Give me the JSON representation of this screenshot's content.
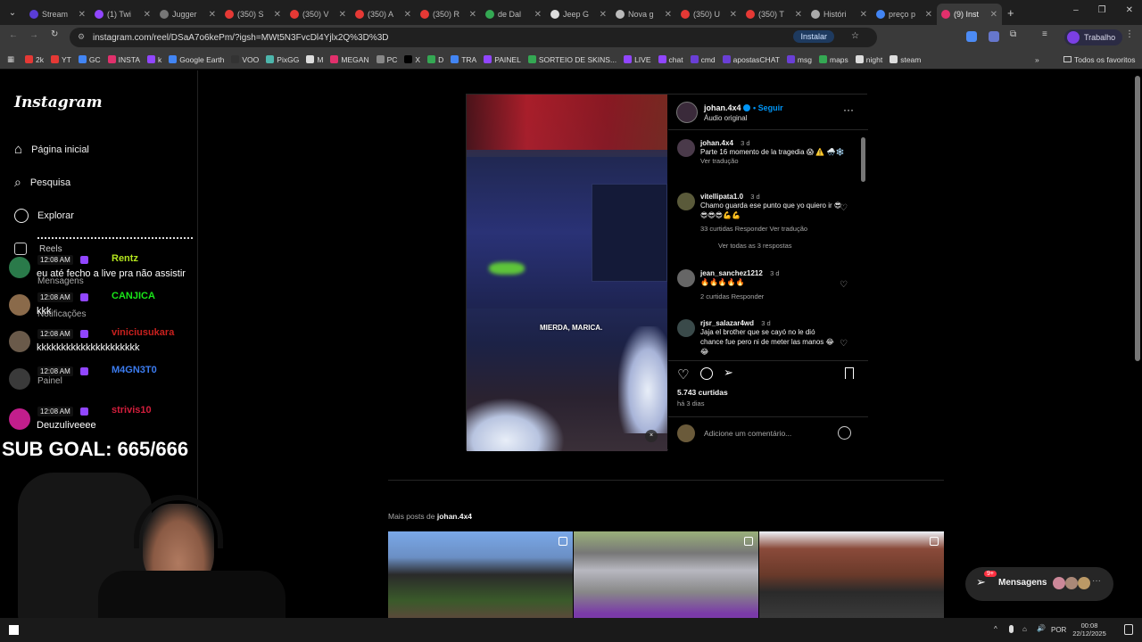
{
  "browser": {
    "tabs": [
      {
        "label": "Stream",
        "color": "#5a3dd6"
      },
      {
        "label": "(1) Twi",
        "color": "#9146ff"
      },
      {
        "label": "Jugger",
        "color": "#777777"
      },
      {
        "label": "(350) S",
        "color": "#e53935"
      },
      {
        "label": "(350) V",
        "color": "#e53935"
      },
      {
        "label": "(350) A",
        "color": "#e53935"
      },
      {
        "label": "(350) R",
        "color": "#e53935"
      },
      {
        "label": "de Dal",
        "color": "#34a853"
      },
      {
        "label": "Jeep G",
        "color": "#dddddd"
      },
      {
        "label": "Nova g",
        "color": "#bbbbbb"
      },
      {
        "label": "(350) U",
        "color": "#e53935"
      },
      {
        "label": "(350) T",
        "color": "#e53935"
      },
      {
        "label": "Históri",
        "color": "#aaaaaa"
      },
      {
        "label": "preço p",
        "color": "#4285f4"
      },
      {
        "label": "(9) Inst",
        "color": "#e1306c"
      }
    ],
    "url": "instagram.com/reel/DSaA7o6kePm/?igsh=MWt5N3FvcDl4Yjlx2Q%3D%3D",
    "install_label": "Instalar",
    "profile_label": "Trabalho",
    "bookmarks": [
      "2k",
      "YT",
      "GC",
      "INSTA",
      "k",
      "Google Earth",
      "VOO",
      "PixGG",
      "M",
      "MEGAN",
      "PC",
      "X",
      "D",
      "TRA",
      "PAINEL",
      "SORTEIO DE SKINS...",
      "LIVE",
      "chat",
      "cmd",
      "apostasCHAT",
      "msg",
      "maps",
      "night",
      "steam"
    ],
    "all_bookmarks": "Todos os favoritos"
  },
  "instagram": {
    "logo": "Instagram",
    "nav": [
      "Página inicial",
      "Pesquisa",
      "Explorar",
      "Reels",
      "Mensagens",
      "Notificações",
      "Painel"
    ],
    "post": {
      "author": "johan.4x4",
      "follow": "Seguir",
      "audio": "Áudio original",
      "video_caption": "MIERDA, MARICA.",
      "likes": "5.743 curtidas",
      "time": "há 3 dias",
      "comment_placeholder": "Adicione um comentário...",
      "comments": [
        {
          "user": "johan.4x4",
          "time": "3 d",
          "text": "Parte 16 momento de la tragedia 😱 ⚠️ 🌨️❄️",
          "sub": "Ver tradução"
        },
        {
          "user": "vitellipata1.0",
          "time": "3 d",
          "text": "Chamo guarda ese punto que yo quiero ir 😎😎😎😎💪💪",
          "sub": "33 curtidas   Responder   Ver tradução",
          "replies": "Ver todas as 3 respostas"
        },
        {
          "user": "jean_sanchez1212",
          "time": "3 d",
          "text": "🔥🔥🔥🔥🔥",
          "sub": "2 curtidas   Responder"
        },
        {
          "user": "rjsr_salazar4wd",
          "time": "3 d",
          "text": "Jaja el brother que se cayó no le dió chance fue pero ni de meter las manos 😂😂",
          "sub": ""
        }
      ]
    },
    "more_posts_label": "Mais posts de",
    "more_posts_user": "johan.4x4",
    "messages_label": "Mensagens",
    "messages_badge": "9+"
  },
  "stream_overlay": {
    "chat": [
      {
        "time": "12:08 AM",
        "user": "Rentz",
        "user_color": "#b4e61e",
        "msg": "eu até fecho a live pra não assistir",
        "avatar": "#2a7a4a"
      },
      {
        "time": "12:08 AM",
        "user": "CANJICA",
        "user_color": "#19e619",
        "msg": "kkk",
        "avatar": "#8a6a4a"
      },
      {
        "time": "12:08 AM",
        "user": "viniciusukara",
        "user_color": "#c8201e",
        "msg": "kkkkkkkkkkkkkkkkkkkkk",
        "avatar": "#6a5a4a"
      },
      {
        "time": "12:08 AM",
        "user": "M4GN3T0",
        "user_color": "#3c7cf0",
        "msg": "",
        "avatar": "#3a3a3a"
      },
      {
        "time": "12:08 AM",
        "user": "strivis10",
        "user_color": "#d21e3c",
        "msg": "Deuzuliveeee",
        "avatar": "#c21e8c"
      }
    ],
    "sub_goal": "SUB GOAL: 665/666"
  },
  "taskbar": {
    "lang": "POR",
    "time": "00:08",
    "date": "22/12/2025"
  }
}
